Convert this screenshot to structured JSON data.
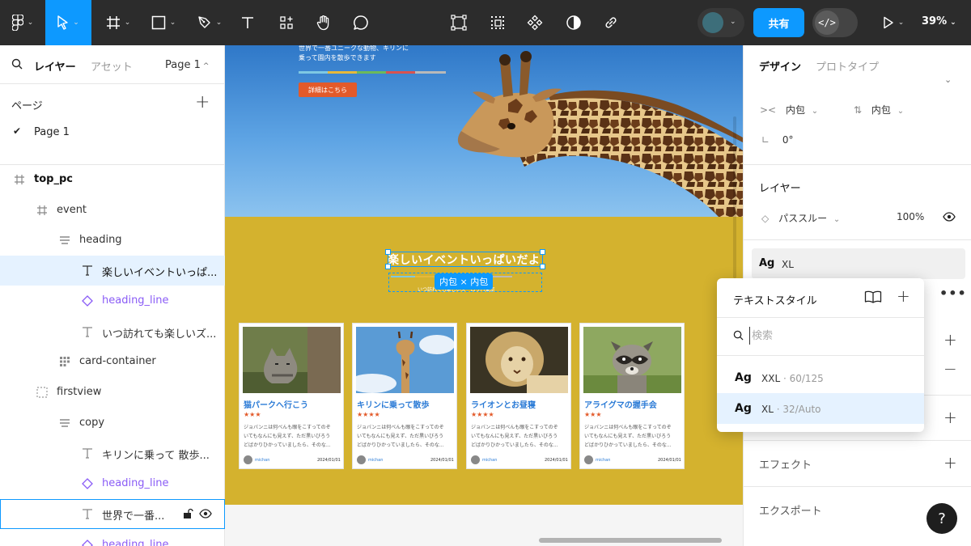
{
  "toolbar": {
    "share_label": "共有",
    "dev_label": "</>",
    "zoom": "39%",
    "chevron": "⌄"
  },
  "left_panel": {
    "tab_layers": "レイヤー",
    "tab_assets": "アセット",
    "page_selector": "Page 1",
    "pages_title": "ページ",
    "add_symbol": "+",
    "current_page": "Page 1",
    "layers": [
      {
        "name": "top_pc",
        "icon": "frame-icon"
      },
      {
        "name": "event",
        "icon": "frame-icon"
      },
      {
        "name": "heading",
        "icon": "auto-layout-icon"
      },
      {
        "name": "楽しいイベントいっぱ...",
        "icon": "text-icon"
      },
      {
        "name": "heading_line",
        "icon": "component-instance-icon"
      },
      {
        "name": "いつ訪れても楽しいズ...",
        "icon": "text-icon"
      },
      {
        "name": "card-container",
        "icon": "grid-icon"
      },
      {
        "name": "firstview",
        "icon": "section-icon"
      },
      {
        "name": "copy",
        "icon": "auto-layout-icon"
      },
      {
        "name": "キリンに乗って 散歩...",
        "icon": "text-icon"
      },
      {
        "name": "heading_line",
        "icon": "component-instance-icon"
      },
      {
        "name": "世界で一番...",
        "icon": "text-icon"
      },
      {
        "name": "heading_line",
        "icon": "component-instance-icon"
      }
    ]
  },
  "canvas": {
    "hero": {
      "text_line1": "世界で一番ユニークな動物、キリンに",
      "text_line2": "乗って園内を散歩できます",
      "button": "詳細はこちら"
    },
    "event": {
      "title": "楽しいイベントいっぱいだよ",
      "subtitle": "いつ訪れても楽しいズーロッパ東京",
      "size_badge": "内包 × 内包"
    },
    "cards": [
      {
        "title": "猫パークへ行こう",
        "stars": "★★★",
        "body1": "ジョバンニは何べんも眼をこすってのぞ",
        "body2": "いてもなんにも見えず、ただ黒いびろう",
        "body3": "どばかりひかっていましたら、そのな...",
        "author": "michan",
        "date": "2024/01/01"
      },
      {
        "title": "キリンに乗って散歩",
        "stars": "★★★★",
        "body1": "ジョバンニは何べんも眼をこすってのぞ",
        "body2": "いてもなんにも見えず、ただ黒いびろう",
        "body3": "どばかりひかっていましたら、そのな...",
        "author": "michan",
        "date": "2024/01/01"
      },
      {
        "title": "ライオンとお昼寝",
        "stars": "★★★★",
        "body1": "ジョバンニは何べんも眼をこすってのぞ",
        "body2": "いてもなんにも見えず、ただ黒いびろう",
        "body3": "どばかりひかっていましたら、そのな...",
        "author": "michan",
        "date": "2024/01/01"
      },
      {
        "title": "アライグマの握手会",
        "stars": "★★★",
        "body1": "ジョバンニは何べんも眼をこすってのぞ",
        "body2": "いてもなんにも見えず、ただ黒いびろう",
        "body3": "どばかりひかっていましたら、そのな...",
        "author": "michan",
        "date": "2024/01/01"
      }
    ]
  },
  "right_panel": {
    "tab_design": "デザイン",
    "tab_prototype": "プロトタイプ",
    "hug_label": "内包",
    "rotation": "0°",
    "layer_title": "レイヤー",
    "blend_mode": "パススルー",
    "opacity": "100%",
    "text_style_ag": "Ag",
    "text_style_name": "XL",
    "effects": "エフェクト",
    "export": "エクスポート",
    "help": "?"
  },
  "popup": {
    "title": "テキストスタイル",
    "search_placeholder": "検索",
    "items": [
      {
        "ag": "Ag",
        "name": "XXL",
        "detail": " · 60/125"
      },
      {
        "ag": "Ag",
        "name": "XL",
        "detail": " · 32/Auto"
      }
    ]
  },
  "colors": {
    "accent": "#0d99ff",
    "toolbar": "#2c2c2c",
    "event_bg": "#d4b22e",
    "hero_button": "#e35a2a",
    "component": "#8a5cf6"
  }
}
